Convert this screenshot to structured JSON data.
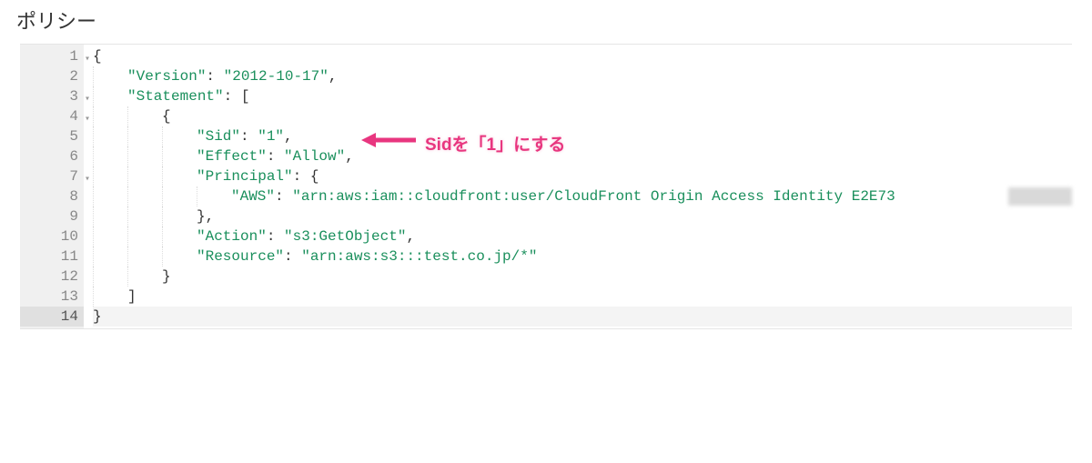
{
  "title": "ポリシー",
  "editor": {
    "active_line": 14,
    "lines": [
      {
        "num": 1,
        "fold": true,
        "tokens": [
          {
            "t": "{",
            "c": "brace"
          }
        ]
      },
      {
        "num": 2,
        "fold": false,
        "indent": 1,
        "tokens": [
          {
            "t": "\"Version\"",
            "c": "key"
          },
          {
            "t": ": ",
            "c": "pun"
          },
          {
            "t": "\"2012-10-17\"",
            "c": "str"
          },
          {
            "t": ",",
            "c": "pun"
          }
        ]
      },
      {
        "num": 3,
        "fold": true,
        "indent": 1,
        "tokens": [
          {
            "t": "\"Statement\"",
            "c": "key"
          },
          {
            "t": ": [",
            "c": "pun"
          }
        ]
      },
      {
        "num": 4,
        "fold": true,
        "indent": 2,
        "tokens": [
          {
            "t": "{",
            "c": "brace"
          }
        ]
      },
      {
        "num": 5,
        "fold": false,
        "indent": 3,
        "tokens": [
          {
            "t": "\"Sid\"",
            "c": "key"
          },
          {
            "t": ": ",
            "c": "pun"
          },
          {
            "t": "\"1\"",
            "c": "str"
          },
          {
            "t": ",",
            "c": "pun"
          }
        ]
      },
      {
        "num": 6,
        "fold": false,
        "indent": 3,
        "tokens": [
          {
            "t": "\"Effect\"",
            "c": "key"
          },
          {
            "t": ": ",
            "c": "pun"
          },
          {
            "t": "\"Allow\"",
            "c": "str"
          },
          {
            "t": ",",
            "c": "pun"
          }
        ]
      },
      {
        "num": 7,
        "fold": true,
        "indent": 3,
        "tokens": [
          {
            "t": "\"Principal\"",
            "c": "key"
          },
          {
            "t": ": {",
            "c": "pun"
          }
        ]
      },
      {
        "num": 8,
        "fold": false,
        "indent": 4,
        "tokens": [
          {
            "t": "\"AWS\"",
            "c": "key"
          },
          {
            "t": ": ",
            "c": "pun"
          },
          {
            "t": "\"arn:aws:iam::cloudfront:user/CloudFront Origin Access Identity E2E73",
            "c": "str"
          }
        ]
      },
      {
        "num": 9,
        "fold": false,
        "indent": 3,
        "tokens": [
          {
            "t": "},",
            "c": "pun"
          }
        ]
      },
      {
        "num": 10,
        "fold": false,
        "indent": 3,
        "tokens": [
          {
            "t": "\"Action\"",
            "c": "key"
          },
          {
            "t": ": ",
            "c": "pun"
          },
          {
            "t": "\"s3:GetObject\"",
            "c": "str"
          },
          {
            "t": ",",
            "c": "pun"
          }
        ]
      },
      {
        "num": 11,
        "fold": false,
        "indent": 3,
        "tokens": [
          {
            "t": "\"Resource\"",
            "c": "key"
          },
          {
            "t": ": ",
            "c": "pun"
          },
          {
            "t": "\"arn:aws:s3:::test.co.jp/*\"",
            "c": "str"
          }
        ]
      },
      {
        "num": 12,
        "fold": false,
        "indent": 2,
        "tokens": [
          {
            "t": "}",
            "c": "brace"
          }
        ]
      },
      {
        "num": 13,
        "fold": false,
        "indent": 1,
        "tokens": [
          {
            "t": "]",
            "c": "pun"
          }
        ]
      },
      {
        "num": 14,
        "fold": false,
        "tokens": [
          {
            "t": "}",
            "c": "brace"
          }
        ]
      }
    ]
  },
  "annotation": {
    "text": "Sidを「1」にする",
    "arrow_color": "#e8367f"
  }
}
